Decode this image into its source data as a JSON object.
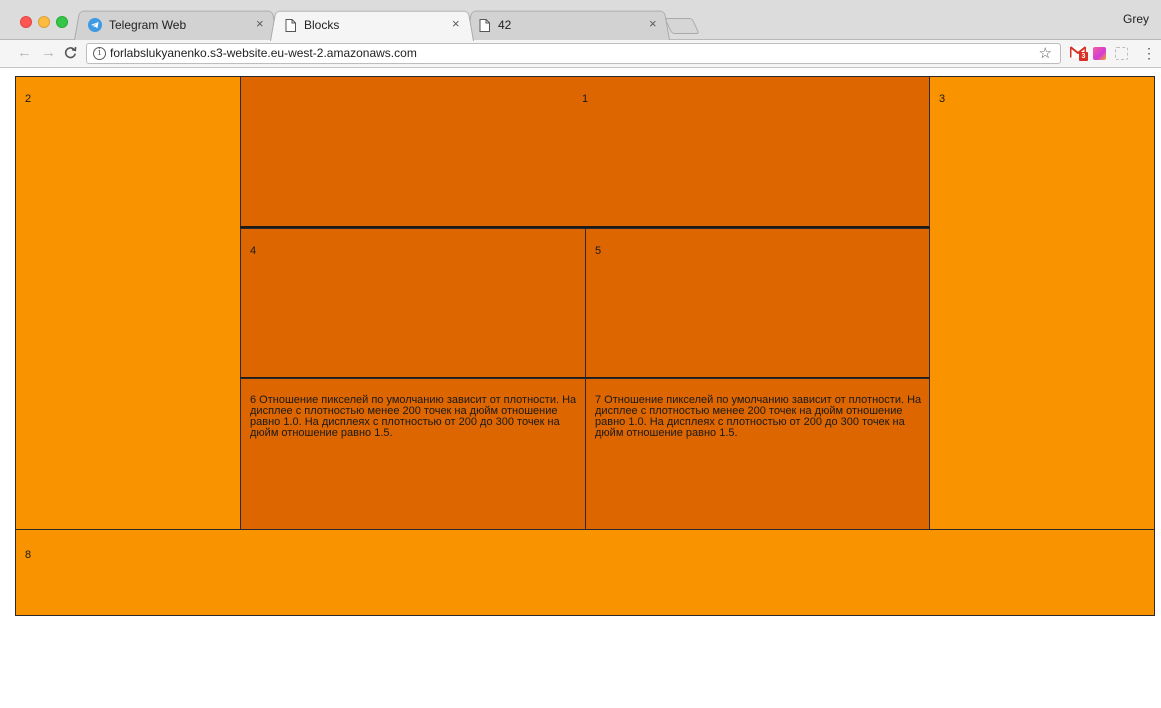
{
  "browser": {
    "tabs": [
      {
        "title": "Telegram Web",
        "icon": "telegram-icon",
        "active": false
      },
      {
        "title": "Blocks",
        "icon": "page-icon",
        "active": true
      },
      {
        "title": "42",
        "icon": "page-icon",
        "active": false
      }
    ],
    "close_glyph": "×",
    "profile_name": "Grey",
    "url": "forlabslukyanenko.s3-website.eu-west-2.amazonaws.com",
    "gmail_badge": "3"
  },
  "page": {
    "blocks": {
      "b1": "1",
      "b2": "2",
      "b3": "3",
      "b4": "4",
      "b5": "5",
      "b6": "6 Отношение пикселей по умолчанию зависит от плотности. На дисплее с плотностью менее 200 точек на дюйм отношение равно 1.0. На дисплеях с плотностью от 200 до 300 точек на дюйм отношение равно 1.5.",
      "b7": "7 Отношение пикселей по умолчанию зависит от плотности. На дисплее с плотностью менее 200 точек на дюйм отношение равно 1.0. На дисплеях с плотностью от 200 до 300 точек на дюйм отношение равно 1.5.",
      "b8": "8"
    },
    "colors": {
      "light_block": "#f99300",
      "dark_block": "#dd6600"
    }
  }
}
